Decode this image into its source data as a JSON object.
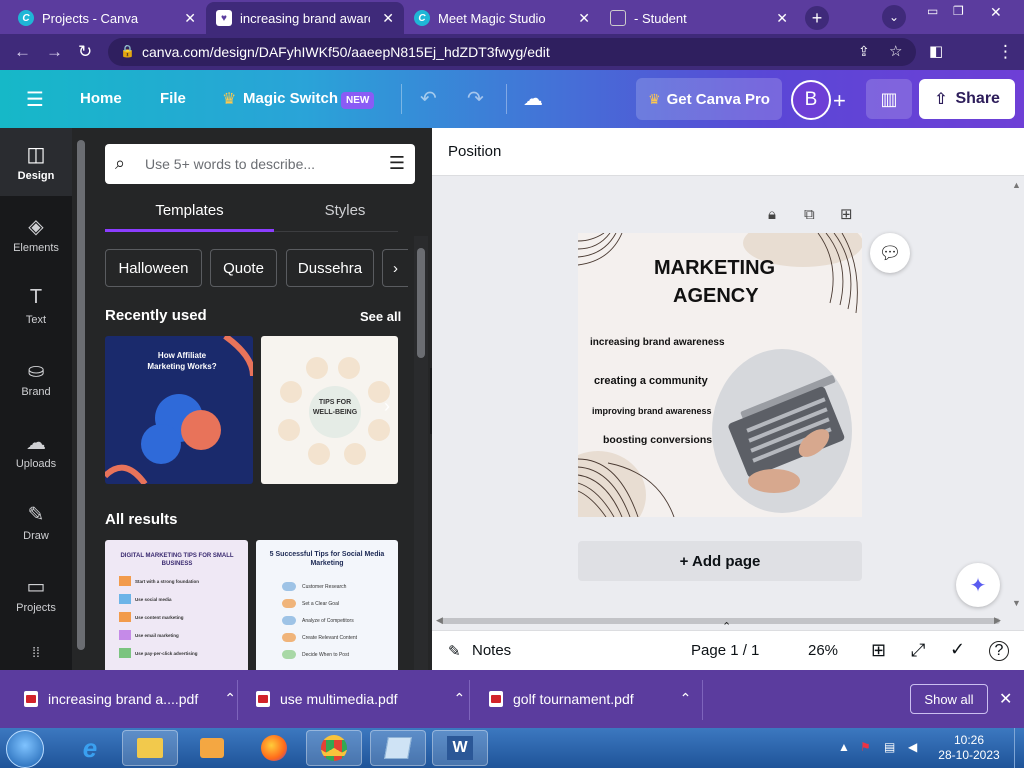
{
  "browser": {
    "tabs": [
      {
        "label": "Projects - Canva",
        "icon": "canva-favicon",
        "active": false
      },
      {
        "label": "increasing brand awarene",
        "icon": "heart-favicon",
        "active": true
      },
      {
        "label": "Meet Magic Studio",
        "icon": "canva-favicon",
        "active": false
      },
      {
        "label": "- Student",
        "icon": "student-favicon",
        "active": false
      }
    ],
    "url": "canva.com/design/DAFyhIWKf50/aaeepN815Ej_hdZDT3fwyg/edit"
  },
  "header": {
    "home": "Home",
    "file": "File",
    "magic_switch": "Magic Switch",
    "new_badge": "NEW",
    "get_pro": "Get Canva Pro",
    "avatar_letter": "B",
    "share": "Share"
  },
  "leftnav": {
    "items": [
      {
        "label": "Design",
        "icon": "design-icon",
        "glyph": "◫"
      },
      {
        "label": "Elements",
        "icon": "elements-icon",
        "glyph": "◈"
      },
      {
        "label": "Text",
        "icon": "text-icon",
        "glyph": "T"
      },
      {
        "label": "Brand",
        "icon": "brand-icon",
        "glyph": "⛀"
      },
      {
        "label": "Uploads",
        "icon": "uploads-icon",
        "glyph": "☁"
      },
      {
        "label": "Draw",
        "icon": "draw-icon",
        "glyph": "✎"
      },
      {
        "label": "Projects",
        "icon": "projects-icon",
        "glyph": "▭"
      }
    ]
  },
  "panel": {
    "search_placeholder": "Use 5+ words to describe...",
    "tabs": [
      "Templates",
      "Styles"
    ],
    "chips": [
      "Halloween",
      "Quote",
      "Dussehra"
    ],
    "recently_used": "Recently used",
    "see_all": "See all",
    "all_results": "All results",
    "thumb1_title": "How Affiliate Marketing Works?",
    "thumb2_title": "TIPS FOR WELL-BEING",
    "thumb3_title": "DIGITAL MARKETING TIPS FOR SMALL BUSINESS",
    "thumb3_items": [
      "Start with a strong foundation",
      "Use social media",
      "Use content marketing",
      "Use email marketing",
      "Use pay-per-click advertising"
    ],
    "thumb4_title": "5 Successful Tips for Social Media Marketing",
    "thumb4_items": [
      "Customer Research",
      "Set a Clear Goal",
      "Analyze of Competitors",
      "Create Relevant Content",
      "Decide When to Post"
    ]
  },
  "canvas": {
    "position_label": "Position",
    "title_line1": "MARKETING",
    "title_line2": "AGENCY",
    "bullets": [
      "increasing brand awareness",
      "creating a community",
      "improving brand awareness",
      "boosting conversions"
    ],
    "add_page": "+ Add page"
  },
  "bottombar": {
    "notes": "Notes",
    "page": "Page 1 / 1",
    "zoom": "26%"
  },
  "downloads": {
    "files": [
      "increasing brand a....pdf",
      "use multimedia.pdf",
      "golf tournament.pdf"
    ],
    "show_all": "Show all"
  },
  "taskbar": {
    "time": "10:26",
    "date": "28-10-2023"
  },
  "colors": {
    "browser_frame": "#5b3c9e",
    "canva_accent": "#8b3dff",
    "panel_bg": "#252627"
  }
}
